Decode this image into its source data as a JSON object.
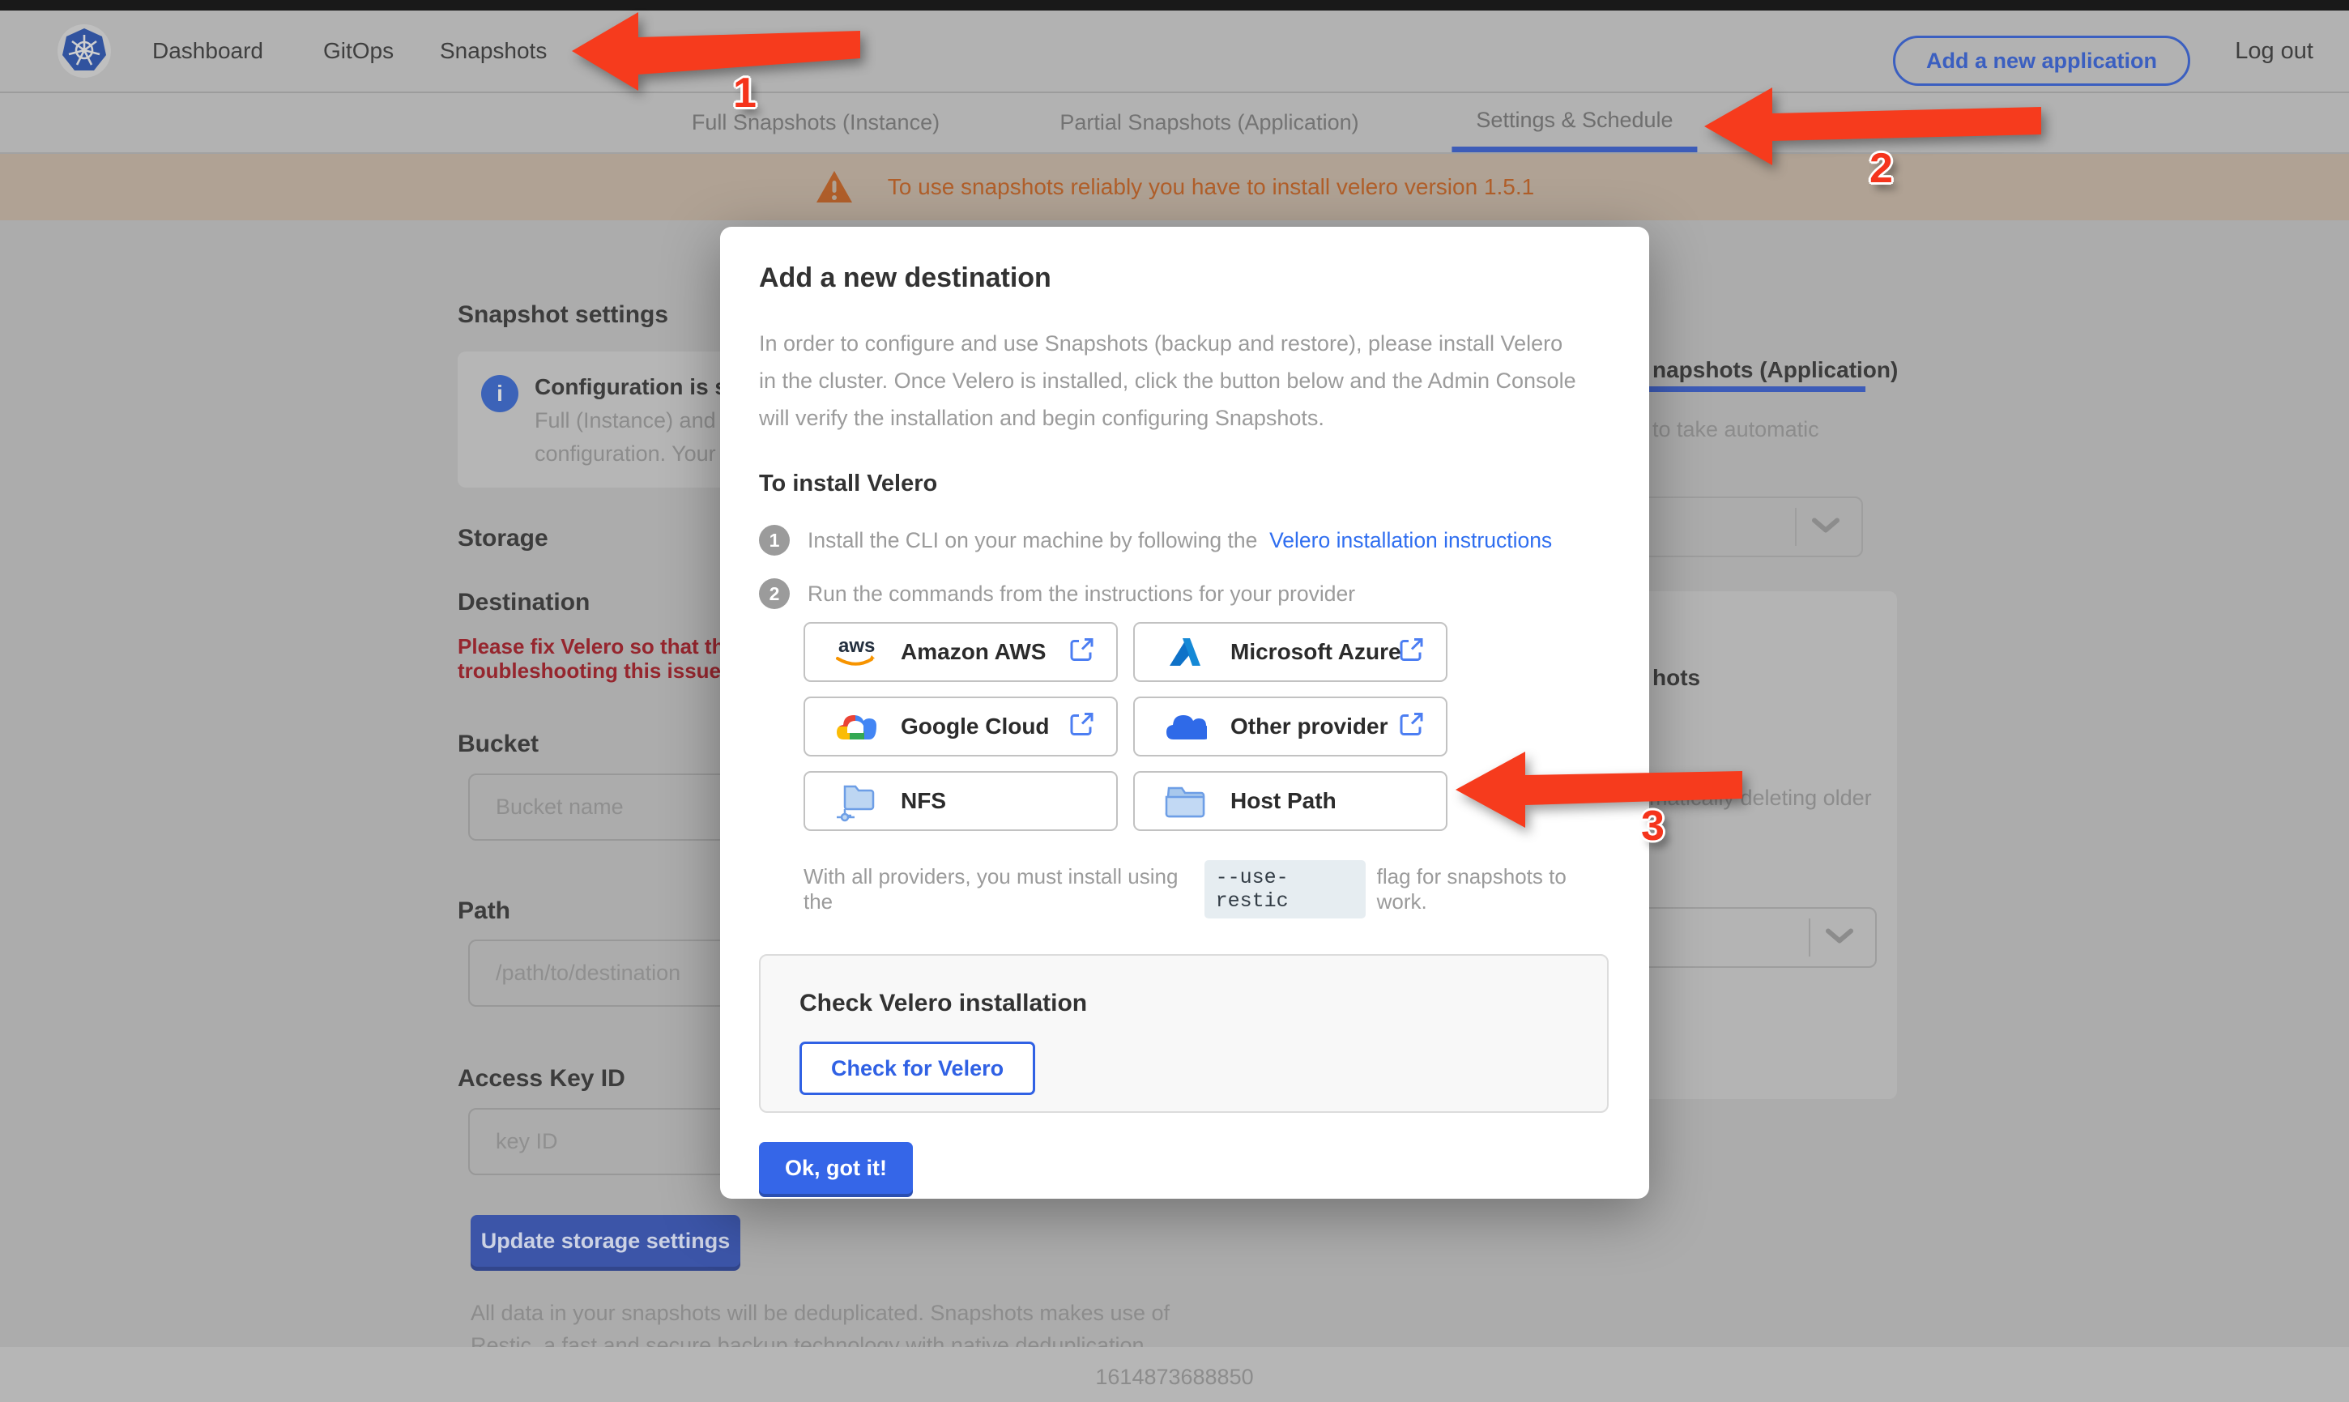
{
  "nav": {
    "items": {
      "dashboard": "Dashboard",
      "gitops": "GitOps",
      "snapshots": "Snapshots"
    },
    "add_app_label": "Add a new application",
    "logout_label": "Log out"
  },
  "tabs": {
    "full": "Full Snapshots (Instance)",
    "partial": "Partial Snapshots (Application)",
    "settings": "Settings & Schedule"
  },
  "banner": {
    "text": "To use snapshots reliably you have to install velero version 1.5.1"
  },
  "settings_page": {
    "title": "Snapshot settings",
    "info_title": "Configuration is sh",
    "info_line1": "Full (Instance) and Parti",
    "info_line2": "configuration. Your stor",
    "storage_heading": "Storage",
    "destination_heading": "Destination",
    "error_line1": "Please fix Velero so that th",
    "error_line2": "troubleshooting this issue",
    "bucket_label": "Bucket",
    "bucket_placeholder": "Bucket name",
    "path_label": "Path",
    "path_placeholder": "/path/to/destination",
    "access_key_label": "Access Key ID",
    "access_key_placeholder": "key ID",
    "update_button": "Update storage settings",
    "footnote_line1": "All data in your snapshots will be deduplicated. Snapshots makes use of",
    "footnote_line2": "Restic, a fast and secure backup technology with native deduplication."
  },
  "right_panel": {
    "tab_partial_text": "napshots (Application)",
    "auto_text": "to take automatic",
    "heading_partial": "hots",
    "retention_text": "matically deleting older"
  },
  "modal": {
    "title": "Add a new destination",
    "description": "In order to configure and use Snapshots (backup and restore), please install Velero in the cluster. Once Velero is installed, click the button below and the Admin Console will verify the installation and begin configuring Snapshots.",
    "install_heading": "To install Velero",
    "step1_num": "1",
    "step1_text": "Install the CLI on your machine by following the",
    "step1_link": "Velero installation instructions",
    "step2_num": "2",
    "step2_text": "Run the commands from the instructions for your provider",
    "providers": {
      "aws": {
        "label": "Amazon AWS"
      },
      "azure": {
        "label": "Microsoft Azure"
      },
      "gcp": {
        "label": "Google Cloud"
      },
      "other": {
        "label": "Other provider"
      },
      "nfs": {
        "label": "NFS"
      },
      "hostpath": {
        "label": "Host Path"
      }
    },
    "restic_before": "With all providers, you must install using the",
    "restic_code": "--use-restic",
    "restic_after": "flag for snapshots to work.",
    "check_title": "Check Velero installation",
    "check_button": "Check for Velero",
    "ok_button": "Ok, got it!"
  },
  "annotations": {
    "one": "1",
    "two": "2",
    "three": "3"
  },
  "footer": {
    "timestamp": "1614873688850"
  },
  "colors": {
    "accent_blue": "#326de6",
    "annotation_red": "#f63b1d",
    "error_red": "#96262e",
    "warning_orange": "#b15f2a"
  }
}
